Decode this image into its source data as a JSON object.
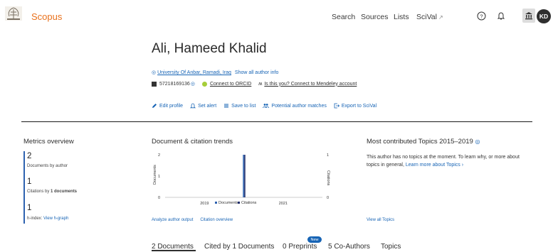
{
  "header": {
    "brand": "Scopus",
    "nav": [
      {
        "label": "Search"
      },
      {
        "label": "Sources"
      },
      {
        "label": "Lists"
      },
      {
        "label": "SciVal",
        "external_icon": "↗"
      }
    ],
    "avatar_initials": "KD",
    "icons": [
      "help-icon",
      "bell-icon",
      "institution-icon"
    ]
  },
  "author": {
    "name": "Ali, Hameed Khalid",
    "affiliation": "University Of Anbar, Ramadi, Iraq",
    "show_all_info": "Show all author info",
    "author_id": "57218169136",
    "orcid": "Connect to ORCID",
    "mendeley": "Is this you? Connect to Mendeley account"
  },
  "actions": [
    {
      "label": "Edit profile",
      "icon": "pencil-icon"
    },
    {
      "label": "Set alert",
      "icon": "bell-icon"
    },
    {
      "label": "Save to list",
      "icon": "list-icon"
    },
    {
      "label": "Potential author matches",
      "icon": "people-icon"
    },
    {
      "label": "Export to SciVal",
      "icon": "export-icon"
    }
  ],
  "metrics": {
    "title": "Metrics overview",
    "documents_value": "2",
    "documents_label": "Documents by author",
    "citations_value": "1",
    "citations_label_pre": "Citations by ",
    "citations_label_bold": "1 documents",
    "hindex_value": "1",
    "hindex_label": "h-index:",
    "hindex_link": "View h-graph"
  },
  "trends": {
    "title": "Document & citation trends",
    "link1": "Analyze author output",
    "link2": "Citation overview"
  },
  "chart_data": {
    "type": "bar",
    "x": [
      "2019",
      "2020",
      "2021"
    ],
    "xlim": [
      2018,
      2022
    ],
    "series": [
      {
        "name": "Documents",
        "axis": "left",
        "color": "#2e62b0",
        "x": [
          2020
        ],
        "values": [
          2
        ]
      },
      {
        "name": "Citations",
        "axis": "right",
        "color": "#1f2d6b",
        "x": [
          2020
        ],
        "values": [
          1
        ]
      }
    ],
    "ylabel_left": "Documents",
    "ylabel_right": "Citations",
    "ylim_left": [
      0,
      2
    ],
    "ylim_right": [
      0,
      1
    ],
    "yticks_left": [
      "2",
      "1",
      "0"
    ],
    "yticks_right": [
      "1",
      "0"
    ],
    "legend": "bottom"
  },
  "topics": {
    "title": "Most contributed Topics 2015–2019",
    "text": "This author has no topics at the moment. To learn why, or more about topics in general,",
    "learn_more": "Learn more about Topics",
    "view_all": "View all Topics"
  },
  "tabs": [
    {
      "label": "2 Documents",
      "active": true
    },
    {
      "label": "Cited by 1 Documents"
    },
    {
      "label": "0 Preprints",
      "badge": "New"
    },
    {
      "label": "5 Co-Authors"
    },
    {
      "label": "Topics"
    }
  ],
  "colors": {
    "brand": "#e9711c",
    "link": "#1764b5",
    "documents": "#2e62b0",
    "citations": "#1f2d6b"
  }
}
